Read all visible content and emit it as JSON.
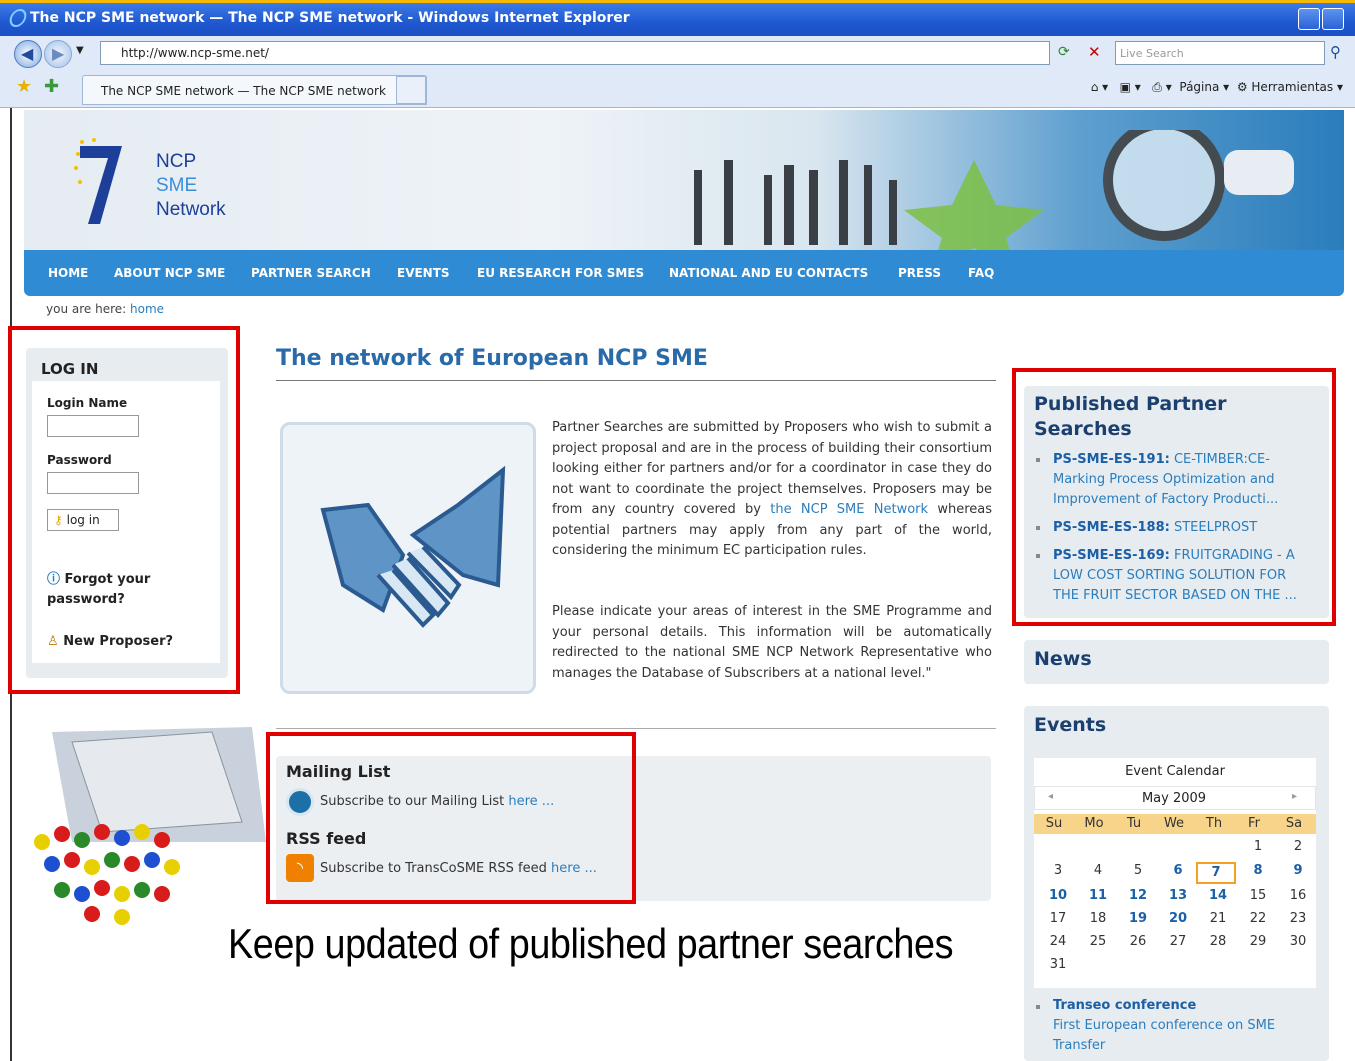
{
  "window": {
    "title": "The NCP SME network — The NCP SME network - Windows Internet Explorer"
  },
  "address": {
    "url": "http://www.ncp-sme.net/",
    "search_placeholder": "Live Search"
  },
  "tab": {
    "label": "The NCP SME network — The NCP SME network"
  },
  "toolbar": {
    "page_label": "Página",
    "tools_label": "Herramientas"
  },
  "logo": {
    "line1": "NCP",
    "line2": "SME",
    "line3": "Network"
  },
  "nav": [
    "HOME",
    "ABOUT NCP SME",
    "PARTNER SEARCH",
    "EVENTS",
    "EU RESEARCH FOR SMES",
    "NATIONAL AND EU CONTACTS",
    "PRESS",
    "FAQ"
  ],
  "breadcrumb": {
    "prefix": "you are here:",
    "link": "home"
  },
  "login": {
    "title": "LOG IN",
    "login_name_label": "Login Name",
    "password_label": "Password",
    "button": "log in",
    "forgot": "Forgot your password?",
    "new_proposer": "New Proposer?"
  },
  "main": {
    "heading": "The network of European NCP SME",
    "para1_a": "Partner Searches are submitted by Proposers who wish to submit a project proposal and are in the process of building their consortium looking either for partners and/or for a coordinator in case they do not want to coordinate the project themselves. Proposers may be from any country covered by",
    "para1_link": "the NCP SME Network",
    "para1_b": "whereas potential partners may apply from any part of the world, considering the minimum EC participation rules.",
    "para2": "Please indicate your areas of interest in the SME Programme and your personal details. This information will be automatically redirected to the national SME NCP Network Representative who manages the Database of Subscribers at a national level.\""
  },
  "mailing": {
    "title": "Mailing List",
    "text": "Subscribe to our Mailing List",
    "link": "here ...",
    "rss_title": "RSS feed",
    "rss_text": "Subscribe to TransCoSME RSS feed",
    "rss_link": "here ..."
  },
  "caption": "Keep updated of published partner searches",
  "partner": {
    "title": "Published Partner Searches",
    "items": [
      {
        "id": "PS-SME-ES-191:",
        "text": "CE-TIMBER:CE-Marking Process Optimization and Improvement of Factory Producti..."
      },
      {
        "id": "PS-SME-ES-188:",
        "text": "STEELPROST"
      },
      {
        "id": "PS-SME-ES-169:",
        "text": "FRUITGRADING - A LOW COST SORTING SOLUTION FOR THE FRUIT SECTOR BASED ON THE ..."
      }
    ]
  },
  "news": {
    "title": "News"
  },
  "events": {
    "title": "Events",
    "calendar_title": "Event Calendar",
    "month": "May 2009",
    "days": [
      "Su",
      "Mo",
      "Tu",
      "We",
      "Th",
      "Fr",
      "Sa"
    ],
    "weeks": [
      [
        "",
        "",
        "",
        "",
        "",
        "1",
        "2"
      ],
      [
        "3",
        "4",
        "5",
        "6",
        "7",
        "8",
        "9"
      ],
      [
        "10",
        "11",
        "12",
        "13",
        "14",
        "15",
        "16"
      ],
      [
        "17",
        "18",
        "19",
        "20",
        "21",
        "22",
        "23"
      ],
      [
        "24",
        "25",
        "26",
        "27",
        "28",
        "29",
        "30"
      ],
      [
        "31",
        "",
        "",
        "",
        "",
        "",
        ""
      ]
    ],
    "linked_days": [
      "6",
      "7",
      "8",
      "9",
      "10",
      "11",
      "12",
      "13",
      "14",
      "19",
      "20"
    ],
    "today": "7",
    "event_title": "Transeo conference",
    "event_desc": "First European conference on SME Transfer"
  },
  "colors": {
    "nav": "#2f8bd3",
    "heading": "#2a6aa8",
    "highlight": "#e00000",
    "calendar_header": "#f7d48a"
  }
}
